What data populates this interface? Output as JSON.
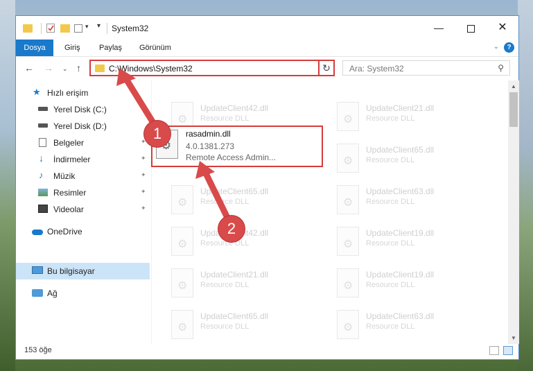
{
  "titlebar": {
    "title": "System32",
    "min": "—",
    "close": "✕"
  },
  "ribbon": {
    "tabs": [
      "Dosya",
      "Giriş",
      "Paylaş",
      "Görünüm"
    ],
    "chevron": "⌄",
    "help": "?"
  },
  "nav": {
    "back": "←",
    "forward": "→",
    "recent": "⌄",
    "up": "↑",
    "address": "C:\\Windows\\System32",
    "address_chevron": "⌄",
    "refresh": "↻",
    "search_placeholder": "Ara: System32",
    "search_icon": "⚲"
  },
  "sidebar": {
    "items": [
      {
        "label": "Hızlı erişim",
        "icon": "star-icon"
      },
      {
        "label": "Yerel Disk (C:)",
        "icon": "drive-icon"
      },
      {
        "label": "Yerel Disk (D:)",
        "icon": "drive-icon"
      },
      {
        "label": "Belgeler",
        "icon": "document-icon"
      },
      {
        "label": "İndirmeler",
        "icon": "download-icon"
      },
      {
        "label": "Müzik",
        "icon": "music-icon"
      },
      {
        "label": "Resimler",
        "icon": "picture-icon"
      },
      {
        "label": "Videolar",
        "icon": "video-icon"
      },
      {
        "label": "OneDrive",
        "icon": "cloud-icon"
      },
      {
        "label": "Bu bilgisayar",
        "icon": "computer-icon"
      },
      {
        "label": "Ağ",
        "icon": "network-icon"
      }
    ]
  },
  "files": [
    {
      "name": "UpdateClient42.dll",
      "type": "Resource DLL"
    },
    {
      "name": "UpdateClient21.dll",
      "type": "Resource DLL"
    },
    {
      "name": "UpdateClient65.dll",
      "type": "Resource DLL"
    },
    {
      "name": "UpdateClient65.dll",
      "type": "Resource DLL"
    },
    {
      "name": "UpdateClient63.dll",
      "type": "Resource DLL"
    },
    {
      "name": "UpdateClient42.dll",
      "type": "Resource DLL"
    },
    {
      "name": "UpdateClient19.dll",
      "type": "Resource DLL"
    },
    {
      "name": "UpdateClient21.dll",
      "type": "Resource DLL"
    },
    {
      "name": "UpdateClient19.dll",
      "type": "Resource DLL"
    },
    {
      "name": "UpdateClient65.dll",
      "type": "Resource DLL"
    },
    {
      "name": "UpdateClient63.dll",
      "type": "Resource DLL"
    }
  ],
  "selected_file": {
    "name": "rasadmin.dll",
    "version": "4.0.1381.273",
    "description": "Remote Access Admin..."
  },
  "status": {
    "count": "153 öğe"
  },
  "annotations": {
    "step1": "1",
    "step2": "2",
    "color": "#d94a4a"
  }
}
